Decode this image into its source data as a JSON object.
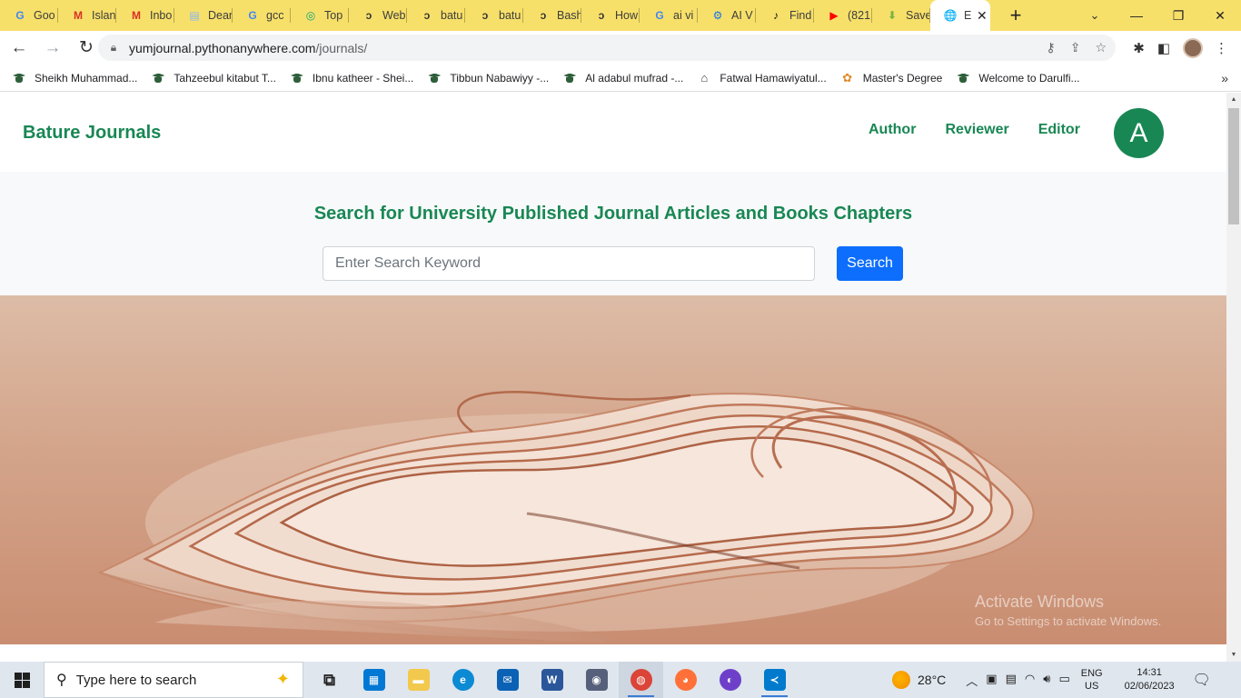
{
  "browser": {
    "tabs": [
      {
        "title": "Goo",
        "icon": "google-icon",
        "color": "#4285f4",
        "glyph": "G"
      },
      {
        "title": "Islan",
        "icon": "gmail-icon",
        "color": "#d93025",
        "glyph": "M"
      },
      {
        "title": "Inbo",
        "icon": "gmail-icon",
        "color": "#d93025",
        "glyph": "M"
      },
      {
        "title": "Dear",
        "icon": "docs-icon",
        "color": "#8ab4f8",
        "glyph": "▤"
      },
      {
        "title": "gcc",
        "icon": "google-icon",
        "color": "#4285f4",
        "glyph": "G"
      },
      {
        "title": "Top",
        "icon": "chatgpt-icon",
        "color": "#10a37f",
        "glyph": "◎"
      },
      {
        "title": "Web",
        "icon": "swirl-icon",
        "color": "#333333",
        "glyph": "ↄ"
      },
      {
        "title": "batu",
        "icon": "swirl-icon",
        "color": "#333333",
        "glyph": "ↄ"
      },
      {
        "title": "batu",
        "icon": "swirl-icon",
        "color": "#333333",
        "glyph": "ↄ"
      },
      {
        "title": "Bash",
        "icon": "swirl-icon",
        "color": "#333333",
        "glyph": "ↄ"
      },
      {
        "title": "How",
        "icon": "swirl-icon",
        "color": "#333333",
        "glyph": "ↄ"
      },
      {
        "title": "ai vi",
        "icon": "google-icon",
        "color": "#4285f4",
        "glyph": "G"
      },
      {
        "title": "AI V",
        "icon": "gear-blue-icon",
        "color": "#1a73e8",
        "glyph": "⚙"
      },
      {
        "title": "Find",
        "icon": "tiktok-icon",
        "color": "#111111",
        "glyph": "♪"
      },
      {
        "title": "(821",
        "icon": "youtube-icon",
        "color": "#ff0000",
        "glyph": "▶"
      },
      {
        "title": "Save",
        "icon": "download-icon",
        "color": "#7cb342",
        "glyph": "⬇"
      },
      {
        "title": "E",
        "icon": "globe-icon",
        "color": "#202124",
        "glyph": "🌐",
        "active": true
      }
    ],
    "url_host": "yumjournal.pythonanywhere.com",
    "url_path": "/journals/",
    "bookmarks": [
      {
        "label": "Sheikh Muhammad...",
        "icon": "graduation-cap-icon"
      },
      {
        "label": "Tahzeebul kitabut T...",
        "icon": "graduation-cap-icon"
      },
      {
        "label": "Ibnu katheer - Shei...",
        "icon": "graduation-cap-icon"
      },
      {
        "label": "Tibbun Nabawiyy -...",
        "icon": "graduation-cap-icon"
      },
      {
        "label": "Al adabul mufrad -...",
        "icon": "graduation-cap-icon"
      },
      {
        "label": "Fatwal Hamawiyatul...",
        "icon": "home-icon"
      },
      {
        "label": "Master's Degree",
        "icon": "flower-icon"
      },
      {
        "label": "Welcome to Darulfi...",
        "icon": "graduation-cap-icon"
      }
    ]
  },
  "site": {
    "brand": "Bature Journals",
    "nav": [
      "Author",
      "Reviewer",
      "Editor"
    ],
    "avatar_letter": "A",
    "hero_title": "Search for University Published Journal Articles and Books Chapters",
    "search_placeholder": "Enter Search Keyword",
    "search_button": "Search",
    "accent": "#198754",
    "button_color": "#0d6efd"
  },
  "watermark": {
    "line1": "Activate Windows",
    "line2": "Go to Settings to activate Windows."
  },
  "taskbar": {
    "search_placeholder": "Type here to search",
    "apps": [
      {
        "name": "task-view",
        "icon": "task-view-icon",
        "color": "#1f1f1f",
        "glyph": "⧉",
        "open": false
      },
      {
        "name": "store",
        "icon": "store-icon",
        "color": "#0078d4",
        "glyph": "▦",
        "open": false
      },
      {
        "name": "file-explorer",
        "icon": "folder-icon",
        "color": "#f2c94c",
        "glyph": "▬",
        "open": false
      },
      {
        "name": "edge",
        "icon": "edge-icon",
        "color": "#0c8ad4",
        "glyph": "e",
        "open": false
      },
      {
        "name": "mail",
        "icon": "mail-icon",
        "color": "#0b62b5",
        "glyph": "✉",
        "open": false
      },
      {
        "name": "word-app",
        "icon": "word-icon",
        "color": "#2b579a",
        "glyph": "W",
        "open": false
      },
      {
        "name": "camera",
        "icon": "camera-icon",
        "color": "#56607a",
        "glyph": "◉",
        "open": false
      },
      {
        "name": "chrome",
        "icon": "chrome-icon",
        "color": "#db4437",
        "glyph": "◍",
        "open": true,
        "active": true
      },
      {
        "name": "firefox",
        "icon": "firefox-icon",
        "color": "#ff7139",
        "glyph": "◕",
        "open": false
      },
      {
        "name": "github-desktop",
        "icon": "github-icon",
        "color": "#6e40c9",
        "glyph": "◐",
        "open": false
      },
      {
        "name": "vscode",
        "icon": "vscode-icon",
        "color": "#007acc",
        "glyph": "≺",
        "open": true
      }
    ],
    "weather": "28°C",
    "lang1": "ENG",
    "lang2": "US",
    "time": "14:31",
    "date": "02/06/2023"
  }
}
